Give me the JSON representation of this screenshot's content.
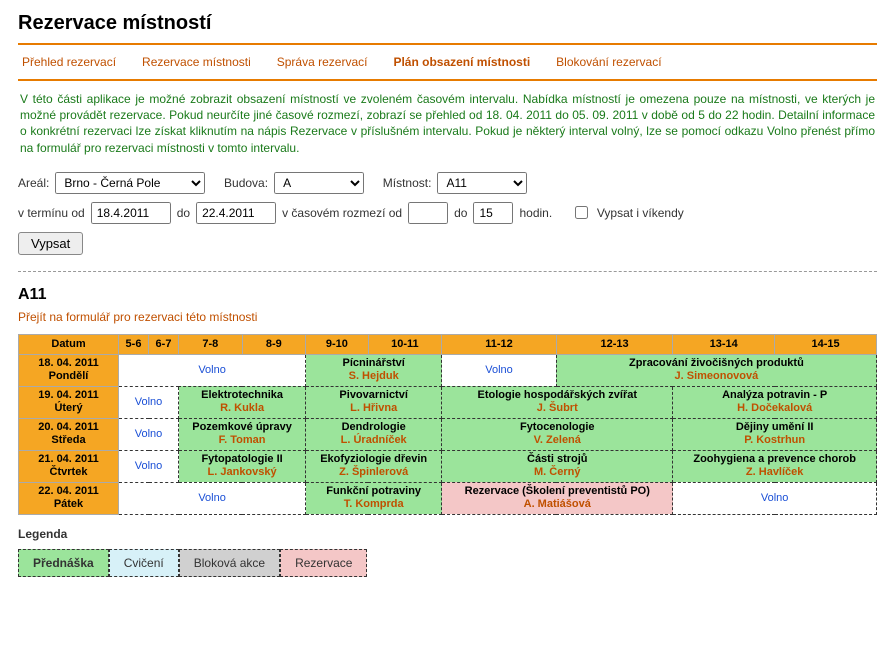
{
  "title": "Rezervace místností",
  "tabs": {
    "overview": "Přehled rezervací",
    "reserve": "Rezervace místnosti",
    "manage": "Správa rezervací",
    "plan": "Plán obsazení místnosti",
    "block": "Blokování rezervací"
  },
  "description": "V této části aplikace je možné zobrazit obsazení místností ve zvoleném časovém intervalu. Nabídka místností je omezena pouze na místnosti, ve kterých je možné provádět rezervace. Pokud neurčíte jiné časové rozmezí, zobrazí se přehled od 18. 04. 2011 do 05. 09. 2011 v době od 5 do 22 hodin. Detailní informace o konkrétní rezervaci lze získat kliknutím na nápis Rezervace v příslušném intervalu. Pokud je některý interval volný, lze se pomocí odkazu Volno přenést přímo na formulář pro rezervaci místnosti v tomto intervalu.",
  "labels": {
    "areal": "Areál:",
    "budova": "Budova:",
    "mistnost": "Místnost:",
    "v_terminu_od": "v termínu od",
    "do": "do",
    "v_casovem_od": "v časovém rozmezí od",
    "hodin": "hodin.",
    "vikendy": "Vypsat i víkendy",
    "vypsat": "Vypsat",
    "room_heading": "A11",
    "form_link": "Přejít na formulář pro rezervaci této místnosti",
    "legend": "Legenda"
  },
  "filters": {
    "areal": "Brno - Černá Pole",
    "budova": "A",
    "mistnost": "A11",
    "date_from": "18.4.2011",
    "date_to": "22.4.2011",
    "time_from": "",
    "time_to": "15",
    "weekends": false
  },
  "headers": {
    "datum": "Datum",
    "t5_6": "5-6",
    "t6_7": "6-7",
    "t7_8": "7-8",
    "t8_9": "8-9",
    "t9_10": "9-10",
    "t10_11": "10-11",
    "t11_12": "11-12",
    "t12_13": "12-13",
    "t13_14": "13-14",
    "t14_15": "14-15"
  },
  "days": {
    "d1_date": "18. 04. 2011",
    "d1_name": "Pondělí",
    "d2_date": "19. 04. 2011",
    "d2_name": "Úterý",
    "d3_date": "20. 04. 2011",
    "d3_name": "Středa",
    "d4_date": "21. 04. 2011",
    "d4_name": "Čtvrtek",
    "d5_date": "22. 04. 2011",
    "d5_name": "Pátek"
  },
  "courses": {
    "volno": "Volno",
    "picn_sub": "Pícninářství",
    "picn_lect": "S. Hejduk",
    "zprod_sub": "Zpracování živočišných produktů",
    "zprod_lect": "J. Simeonovová",
    "elek_sub": "Elektrotechnika",
    "elek_lect": "R. Kukla",
    "pivo_sub": "Pivovarnictví",
    "pivo_lect": "L. Hřivna",
    "etol_sub": "Etologie hospodářských zvířat",
    "etol_lect": "J. Šubrt",
    "anal_sub": "Analýza potravin - P",
    "anal_lect": "H. Dočekalová",
    "pozem_sub": "Pozemkové úpravy",
    "pozem_lect": "F. Toman",
    "dendr_sub": "Dendrologie",
    "dendr_lect": "L. Úradníček",
    "fyto_sub": "Fytocenologie",
    "fyto_lect": "V. Zelená",
    "dejum_sub": "Dějiny umění II",
    "dejum_lect": "P. Kostrhun",
    "fypat_sub": "Fytopatologie II",
    "fypat_lect": "L. Jankovský",
    "ekof_sub": "Ekofyziologie dřevin",
    "ekof_lect": "Z. Špinlerová",
    "casti_sub": "Části strojů",
    "casti_lect": "M. Černý",
    "zooh_sub": "Zoohygiena a prevence chorob",
    "zooh_lect": "Z. Havlíček",
    "funk_sub": "Funkční potraviny",
    "funk_lect": "T. Komprda",
    "rez_sub": "Rezervace (Školení preventistů PO)",
    "rez_lect": "A. Matiášová"
  },
  "legend": {
    "prednaska": "Přednáška",
    "cviceni": "Cvičení",
    "blokova": "Bloková akce",
    "rezervace": "Rezervace"
  },
  "chart_data": {
    "type": "table",
    "room": "A11",
    "time_slots": [
      "5-6",
      "6-7",
      "7-8",
      "8-9",
      "9-10",
      "10-11",
      "11-12",
      "12-13",
      "13-14",
      "14-15"
    ],
    "days": [
      {
        "date": "18. 04. 2011",
        "weekday": "Pondělí",
        "slots": [
          {
            "start": 5,
            "end": 9,
            "type": "free"
          },
          {
            "start": 9,
            "end": 11,
            "type": "prednaska",
            "subject": "Pícninářství",
            "lecturer": "S. Hejduk"
          },
          {
            "start": 11,
            "end": 12,
            "type": "free"
          },
          {
            "start": 12,
            "end": 15,
            "type": "prednaska",
            "subject": "Zpracování živočišných produktů",
            "lecturer": "J. Simeonovová"
          }
        ]
      },
      {
        "date": "19. 04. 2011",
        "weekday": "Úterý",
        "slots": [
          {
            "start": 5,
            "end": 7,
            "type": "free"
          },
          {
            "start": 7,
            "end": 9,
            "type": "prednaska",
            "subject": "Elektrotechnika",
            "lecturer": "R. Kukla"
          },
          {
            "start": 9,
            "end": 11,
            "type": "prednaska",
            "subject": "Pivovarnictví",
            "lecturer": "L. Hřivna"
          },
          {
            "start": 11,
            "end": 13,
            "type": "prednaska",
            "subject": "Etologie hospodářských zvířat",
            "lecturer": "J. Šubrt"
          },
          {
            "start": 13,
            "end": 15,
            "type": "prednaska",
            "subject": "Analýza potravin - P",
            "lecturer": "H. Dočekalová"
          }
        ]
      },
      {
        "date": "20. 04. 2011",
        "weekday": "Středa",
        "slots": [
          {
            "start": 5,
            "end": 7,
            "type": "free"
          },
          {
            "start": 7,
            "end": 9,
            "type": "prednaska",
            "subject": "Pozemkové úpravy",
            "lecturer": "F. Toman"
          },
          {
            "start": 9,
            "end": 11,
            "type": "prednaska",
            "subject": "Dendrologie",
            "lecturer": "L. Úradníček"
          },
          {
            "start": 11,
            "end": 13,
            "type": "prednaska",
            "subject": "Fytocenologie",
            "lecturer": "V. Zelená"
          },
          {
            "start": 13,
            "end": 15,
            "type": "prednaska",
            "subject": "Dějiny umění II",
            "lecturer": "P. Kostrhun"
          }
        ]
      },
      {
        "date": "21. 04. 2011",
        "weekday": "Čtvrtek",
        "slots": [
          {
            "start": 5,
            "end": 7,
            "type": "free"
          },
          {
            "start": 7,
            "end": 9,
            "type": "prednaska",
            "subject": "Fytopatologie II",
            "lecturer": "L. Jankovský"
          },
          {
            "start": 9,
            "end": 11,
            "type": "prednaska",
            "subject": "Ekofyziologie dřevin",
            "lecturer": "Z. Špinlerová"
          },
          {
            "start": 11,
            "end": 13,
            "type": "prednaska",
            "subject": "Části strojů",
            "lecturer": "M. Černý"
          },
          {
            "start": 13,
            "end": 15,
            "type": "prednaska",
            "subject": "Zoohygiena a prevence chorob",
            "lecturer": "Z. Havlíček"
          }
        ]
      },
      {
        "date": "22. 04. 2011",
        "weekday": "Pátek",
        "slots": [
          {
            "start": 5,
            "end": 9,
            "type": "free"
          },
          {
            "start": 9,
            "end": 11,
            "type": "prednaska",
            "subject": "Funkční potraviny",
            "lecturer": "T. Komprda"
          },
          {
            "start": 11,
            "end": 13,
            "type": "rezervace",
            "subject": "Rezervace (Školení preventistů PO)",
            "lecturer": "A. Matiášová"
          },
          {
            "start": 13,
            "end": 15,
            "type": "free"
          }
        ]
      }
    ]
  }
}
